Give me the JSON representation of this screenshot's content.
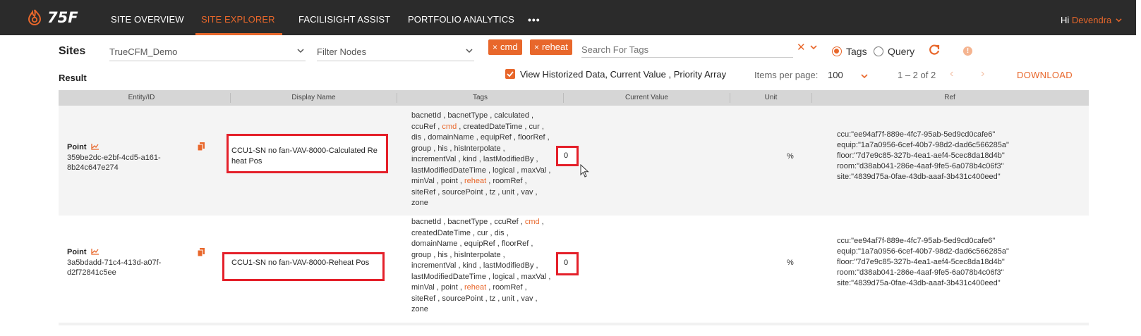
{
  "app": {
    "logo_text": "75F"
  },
  "nav": {
    "items": [
      "SITE OVERVIEW",
      "SITE EXPLORER",
      "FACILISIGHT ASSIST",
      "PORTFOLIO ANALYTICS"
    ],
    "more": "•••",
    "greeting": "Hi",
    "user": "Devendra"
  },
  "filters": {
    "sites_label": "Sites",
    "site_value": "TrueCFM_Demo",
    "nodes_placeholder": "Filter Nodes",
    "chips": [
      "cmd",
      "reheat"
    ],
    "tag_search_placeholder": "Search For Tags",
    "mode_tags": "Tags",
    "mode_query": "Query",
    "selected_mode": "Tags"
  },
  "result": {
    "label": "Result",
    "historized_label": "View Historized Data, Current Value , Priority Array",
    "historized_checked": true,
    "items_per_page_label": "Items per page:",
    "items_per_page": "100",
    "range": "1 – 2 of 2",
    "download": "DOWNLOAD"
  },
  "table": {
    "columns": [
      "Entity/ID",
      "Display Name",
      "Tags",
      "Current Value",
      "Unit",
      "Ref"
    ],
    "rows": [
      {
        "type": "Point",
        "id_line1": "359be2dc-e2bf-4cd5-a161-",
        "id_line2": "8b24c647e274",
        "display_line1": "CCU1-SN no fan-VAV-8000-Calculated Re",
        "display_line2": "heat Pos",
        "tags": [
          [
            "bacnetId",
            "bacnetType",
            "calculated"
          ],
          [
            "ccuRef",
            "cmd",
            "createdDateTime",
            "cur"
          ],
          [
            "dis",
            "domainName",
            "equipRef",
            "floorRef"
          ],
          [
            "group",
            "his",
            "hisInterpolate"
          ],
          [
            "incrementVal",
            "kind",
            "lastModifiedBy"
          ],
          [
            "lastModifiedDateTime",
            "logical",
            "maxVal"
          ],
          [
            "minVal",
            "point",
            "reheat",
            "roomRef"
          ],
          [
            "siteRef",
            "sourcePoint",
            "tz",
            "unit",
            "vav"
          ],
          [
            "zone"
          ]
        ],
        "current_value": "0",
        "unit": "%",
        "refs": [
          "ccu:\"ee94af7f-889e-4fc7-95ab-5ed9cd0cafe6\"",
          "equip:\"1a7a0956-6cef-40b7-98d2-dad6c566285a\"",
          "floor:\"7d7e9c85-327b-4ea1-aef4-5cec8da18d4b\"",
          "room:\"d38ab041-286e-4aaf-9fe5-6a078b4c06f3\"",
          "site:\"4839d75a-0fae-43db-aaaf-3b431c400eed\""
        ]
      },
      {
        "type": "Point",
        "id_line1": "3a5bdadd-71c4-413d-a07f-",
        "id_line2": "d2f72841c5ee",
        "display_line1": "CCU1-SN no fan-VAV-8000-Reheat Pos",
        "display_line2": "",
        "tags": [
          [
            "bacnetId",
            "bacnetType",
            "ccuRef",
            "cmd"
          ],
          [
            "createdDateTime",
            "cur",
            "dis"
          ],
          [
            "domainName",
            "equipRef",
            "floorRef"
          ],
          [
            "group",
            "his",
            "hisInterpolate"
          ],
          [
            "incrementVal",
            "kind",
            "lastModifiedBy"
          ],
          [
            "lastModifiedDateTime",
            "logical",
            "maxVal"
          ],
          [
            "minVal",
            "point",
            "reheat",
            "roomRef"
          ],
          [
            "siteRef",
            "sourcePoint",
            "tz",
            "unit",
            "vav"
          ],
          [
            "zone"
          ]
        ],
        "current_value": "0",
        "unit": "%",
        "refs": [
          "ccu:\"ee94af7f-889e-4fc7-95ab-5ed9cd0cafe6\"",
          "equip:\"1a7a0956-6cef-40b7-98d2-dad6c566285a\"",
          "floor:\"7d7e9c85-327b-4ea1-aef4-5cec8da18d4b\"",
          "room:\"d38ab041-286e-4aaf-9fe5-6a078b4c06f3\"",
          "site:\"4839d75a-0fae-43db-aaaf-3b431c400eed\""
        ]
      }
    ]
  },
  "highlight_tags": [
    "cmd",
    "reheat"
  ],
  "colors": {
    "accent": "#e8672b",
    "nav_bg": "#2b2b2b",
    "annotation_red": "#e4202a",
    "header_bg": "#d6d6d6"
  }
}
